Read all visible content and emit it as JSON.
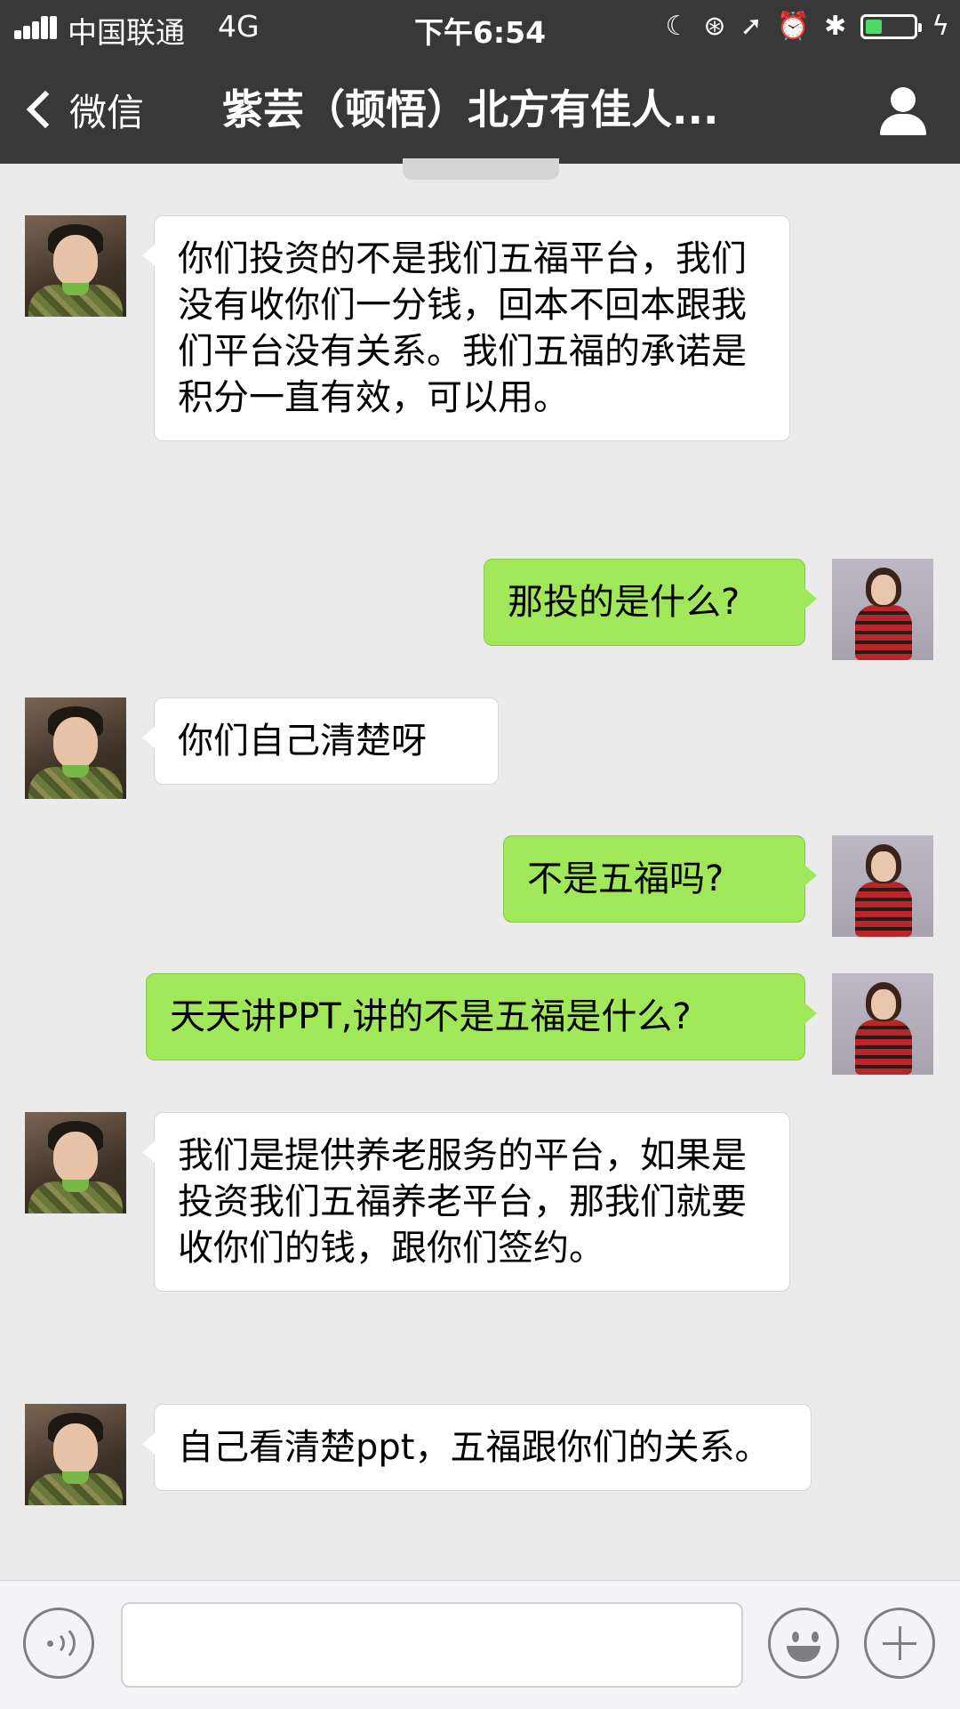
{
  "status_bar": {
    "carrier": "中国联通",
    "network": "4G",
    "time": "下午6:54",
    "icons": [
      "moon-icon",
      "orientation-lock-icon",
      "location-icon",
      "alarm-icon",
      "bluetooth-icon",
      "battery-icon",
      "charging-icon"
    ],
    "battery_level": 0.35,
    "battery_color": "#4cd964"
  },
  "nav": {
    "back_label": "微信",
    "title": "紫芸（顿悟）北方有佳人...",
    "right_icon": "contact-icon"
  },
  "messages": [
    {
      "side": "left",
      "text": "你们投资的不是我们五福平台，我们没有收你们一分钱，回本不回本跟我们平台没有关系。我们五福的承诺是积分一直有效，可以用。"
    },
    {
      "side": "right",
      "text": "那投的是什么?"
    },
    {
      "side": "left",
      "text": "你们自己清楚呀"
    },
    {
      "side": "right",
      "text": "不是五福吗?"
    },
    {
      "side": "right",
      "text": "天天讲PPT,讲的不是五福是什么?"
    },
    {
      "side": "left",
      "text": "我们是提供养老服务的平台，如果是投资我们五福养老平台，那我们就要收你们的钱，跟你们签约。"
    },
    {
      "side": "left",
      "text": "自己看清楚ppt，五福跟你们的关系。"
    }
  ],
  "input_bar": {
    "text_value": "",
    "icons": [
      "voice-icon",
      "emoji-icon",
      "plus-icon"
    ]
  },
  "colors": {
    "nav_bg": "#383838",
    "chat_bg": "#ebebeb",
    "self_bubble": "#a0e75a",
    "other_bubble": "#ffffff"
  }
}
